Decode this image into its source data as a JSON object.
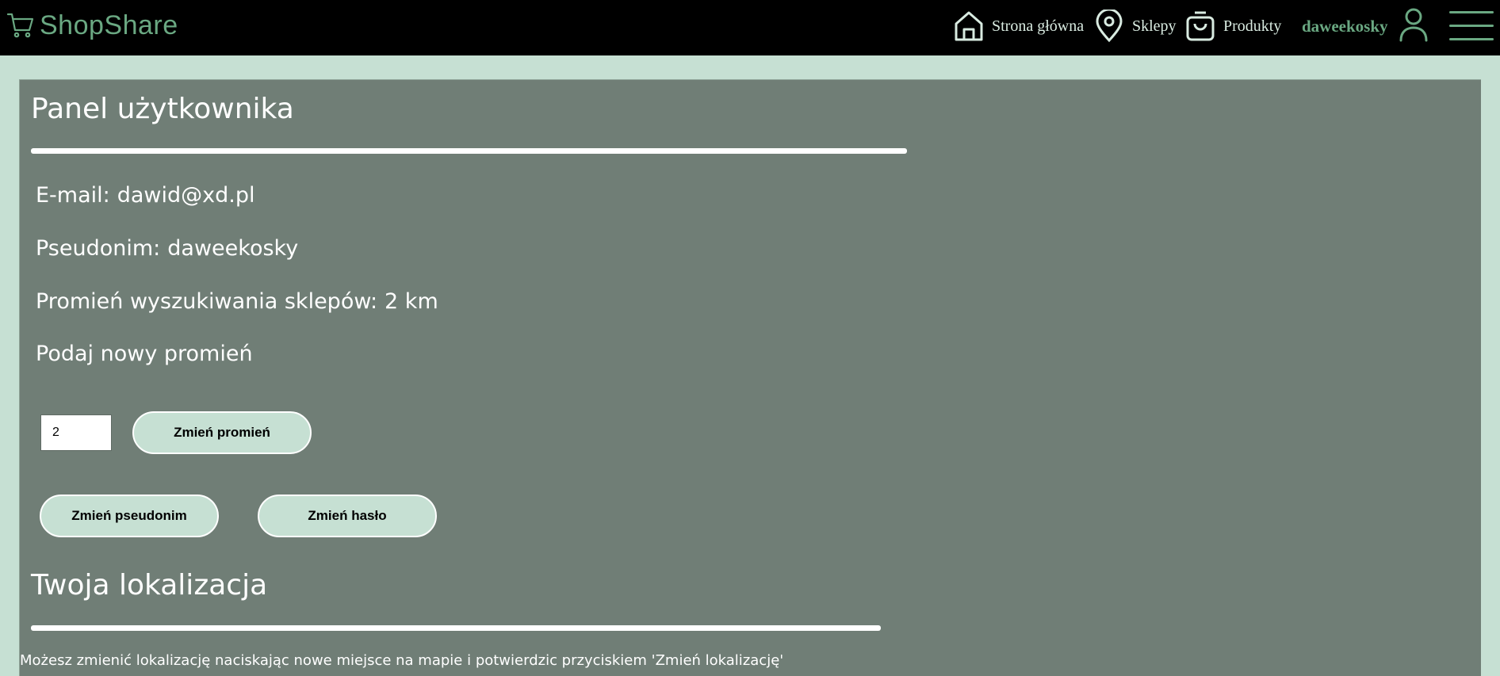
{
  "navbar": {
    "brand": "ShopShare",
    "brand_icon": "cart-icon",
    "items": [
      {
        "label": "Strona główna",
        "icon": "home-icon"
      },
      {
        "label": "Sklepy",
        "icon": "map-pin-icon"
      },
      {
        "label": "Produkty",
        "icon": "shopping-bag-icon"
      }
    ],
    "username": "daweekosky",
    "user_icon": "user-icon",
    "menu_icon": "hamburger-menu-icon"
  },
  "profile": {
    "title": "Panel użytkownika",
    "email_label": "E-mail:",
    "email": "dawid@xd.pl",
    "nickname_label": "Pseudonim:",
    "nickname": "daweekosky",
    "radius_label": "Promień wyszukiwania sklepów:",
    "radius_value": "2 km",
    "new_radius_prompt": "Podaj nowy promień",
    "radius_input_value": "2",
    "change_radius_button": "Zmień promień",
    "change_nickname_button": "Zmień pseudonim",
    "change_password_button": "Zmień hasło"
  },
  "location": {
    "title": "Twoja lokalizacja",
    "hint": "Możesz zmienić lokalizację naciskając nowe miejsce na mapie i potwierdzic przyciskiem 'Zmień lokalizację'"
  },
  "colors": {
    "navbar_bg": "#000000",
    "accent": "#6aa882",
    "page_bg": "#c6e0d3",
    "panel_bg": "#707e76",
    "button_bg": "#c6e0d3"
  }
}
